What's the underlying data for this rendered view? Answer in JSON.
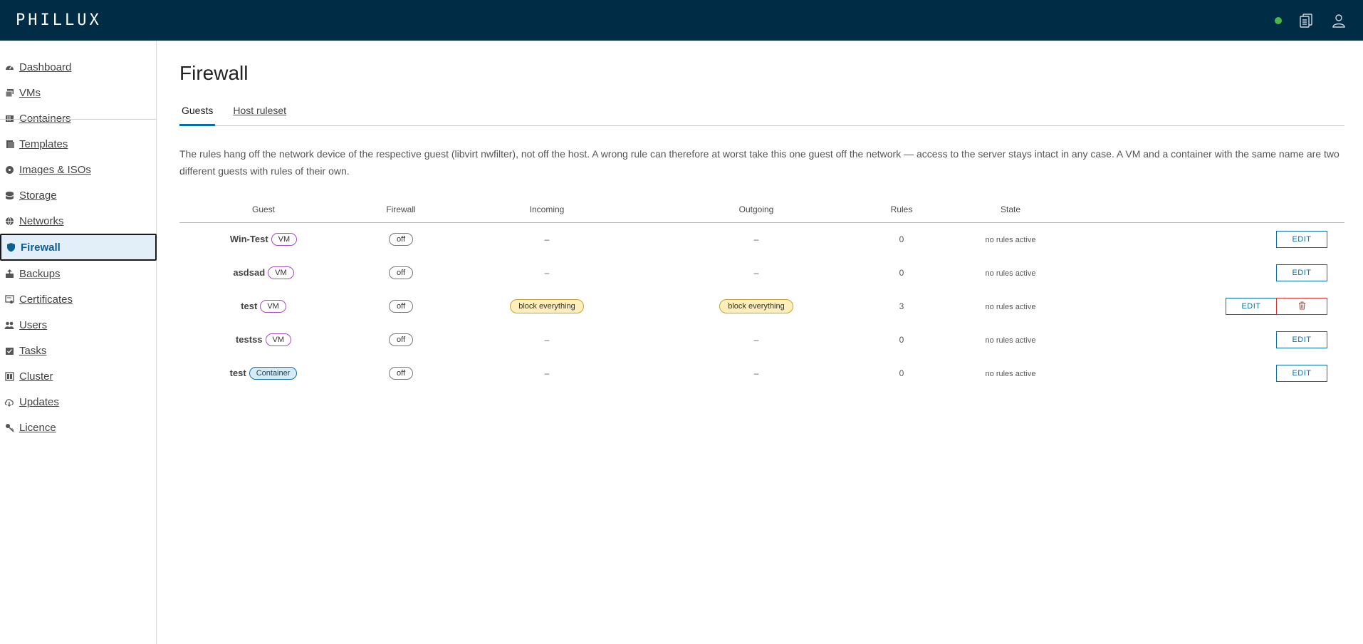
{
  "app": {
    "brand": "PHILLUX"
  },
  "header": {
    "status_color": "#4bb64b",
    "icons": [
      "documents-icon",
      "user-icon"
    ]
  },
  "sidebar": {
    "items": [
      {
        "label": "Dashboard",
        "icon": "dashboard-icon"
      },
      {
        "label": "VMs",
        "icon": "vms-icon"
      },
      {
        "label": "Containers",
        "icon": "containers-icon"
      },
      {
        "label": "Templates",
        "icon": "templates-icon"
      },
      {
        "label": "Images & ISOs",
        "icon": "images-icon"
      },
      {
        "label": "Storage",
        "icon": "storage-icon"
      },
      {
        "label": "Networks",
        "icon": "networks-icon"
      },
      {
        "label": "Firewall",
        "icon": "shield-icon",
        "active": true
      },
      {
        "label": "Backups",
        "icon": "backups-icon"
      },
      {
        "label": "Certificates",
        "icon": "certificates-icon"
      },
      {
        "label": "Users",
        "icon": "users-icon"
      },
      {
        "label": "Tasks",
        "icon": "tasks-icon"
      },
      {
        "label": "Cluster",
        "icon": "cluster-icon"
      },
      {
        "label": "Updates",
        "icon": "updates-icon"
      },
      {
        "label": "Licence",
        "icon": "licence-icon"
      }
    ]
  },
  "main": {
    "title": "Firewall",
    "tabs": [
      {
        "label": "Guests",
        "active": true
      },
      {
        "label": "Host ruleset",
        "active": false
      }
    ],
    "description": "The rules hang off the network device of the respective guest (libvirt nwfilter), not off the host. A wrong rule can therefore at worst take this one guest off the network — access to the server stays intact in any case. A VM and a container with the same name are two different guests with rules of their own.",
    "table": {
      "columns": [
        "Guest",
        "Firewall",
        "Incoming",
        "Outgoing",
        "Rules",
        "State"
      ],
      "rows": [
        {
          "guest": "Win-Test",
          "type": "VM",
          "firewall": "off",
          "incoming": "–",
          "outgoing": "–",
          "rules": "0",
          "state": "no rules active",
          "edit": "EDIT",
          "delete": false
        },
        {
          "guest": "asdsad",
          "type": "VM",
          "firewall": "off",
          "incoming": "–",
          "outgoing": "–",
          "rules": "0",
          "state": "no rules active",
          "edit": "EDIT",
          "delete": false
        },
        {
          "guest": "test",
          "type": "VM",
          "firewall": "off",
          "incoming": "block everything",
          "outgoing": "block everything",
          "rules": "3",
          "state": "no rules active",
          "edit": "EDIT",
          "delete": true
        },
        {
          "guest": "testss",
          "type": "VM",
          "firewall": "off",
          "incoming": "–",
          "outgoing": "–",
          "rules": "0",
          "state": "no rules active",
          "edit": "EDIT",
          "delete": false
        },
        {
          "guest": "test",
          "type": "Container",
          "firewall": "off",
          "incoming": "–",
          "outgoing": "–",
          "rules": "0",
          "state": "no rules active",
          "edit": "EDIT",
          "delete": false
        }
      ]
    }
  },
  "colors": {
    "header_bg": "#002d45",
    "accent": "#0a6fa5",
    "vm_tag_border": "#a34cbd",
    "container_tag_bg": "#d5ecf7",
    "block_pill_bg": "#fdeebb",
    "delete_red": "#d9312b"
  }
}
